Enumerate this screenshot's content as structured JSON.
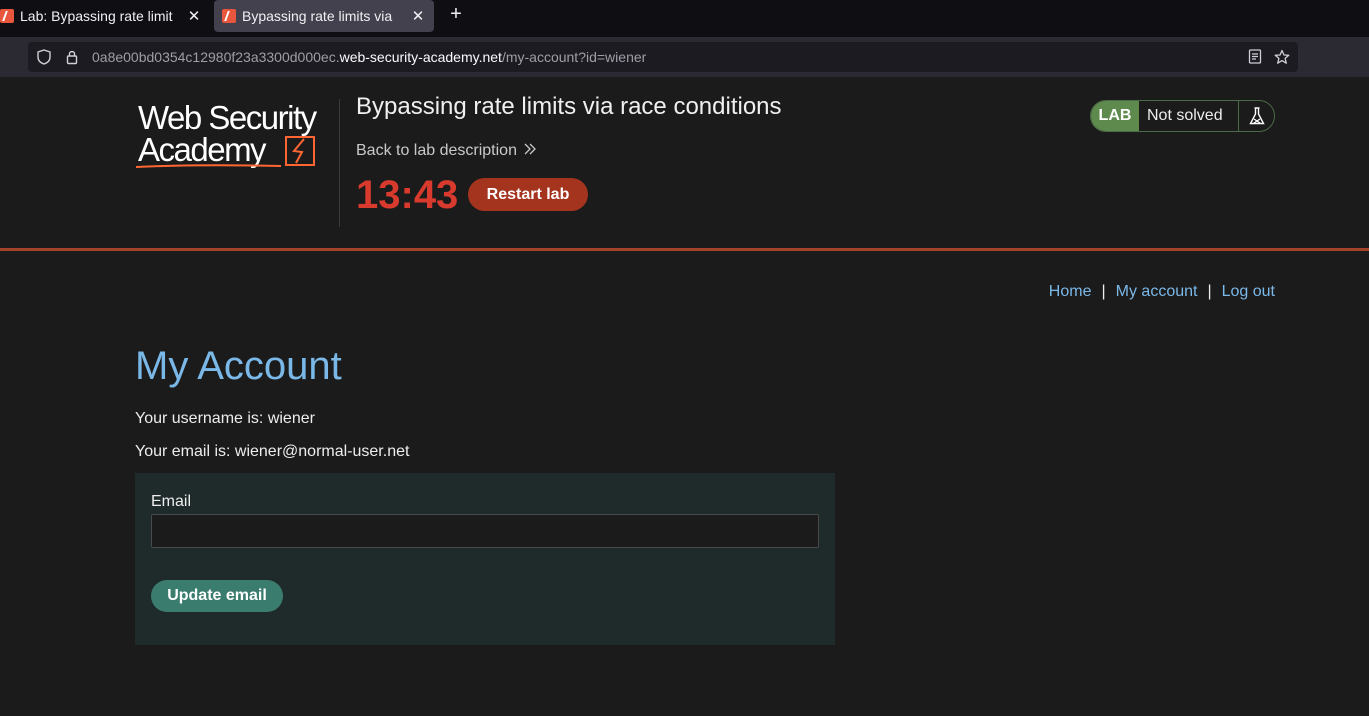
{
  "browser": {
    "tabs": [
      {
        "title": "Lab: Bypassing rate limit"
      },
      {
        "title": "Bypassing rate limits via"
      }
    ],
    "new_tab": "+",
    "close": "✕",
    "url_prefix": "0a8e00bd0354c12980f23a3300d000ec.",
    "url_domain": "web-security-academy.net",
    "url_path": "/my-account?id=wiener"
  },
  "lab": {
    "logo_line1": "Web Security",
    "logo_line2": "Academy",
    "title": "Bypassing rate limits via race conditions",
    "back_link": "Back to lab description",
    "timer": "13:43",
    "restart_label": "Restart lab",
    "status_badge": "LAB",
    "status_text": "Not solved"
  },
  "nav": {
    "home": "Home",
    "my_account": "My account",
    "logout": "Log out",
    "separator": "|"
  },
  "account": {
    "heading": "My Account",
    "username_line": "Your username is: wiener",
    "email_line": "Your email is: wiener@normal-user.net",
    "email_label": "Email",
    "email_value": "",
    "update_label": "Update email"
  },
  "colors": {
    "accent_orange": "#a5341e",
    "timer_red": "#d83a2e",
    "link_blue": "#7ab8e8",
    "lab_green": "#5f8a4e",
    "button_teal": "#3a7d6f"
  }
}
